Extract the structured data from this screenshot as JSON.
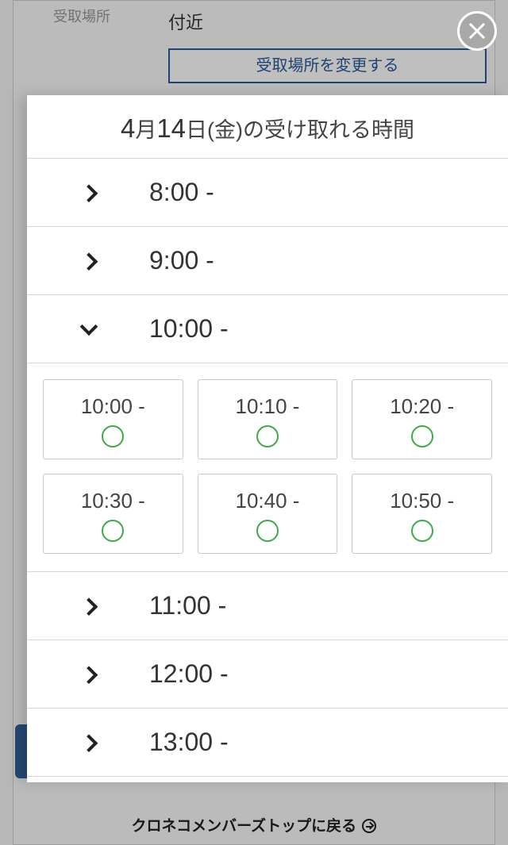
{
  "background": {
    "field_label": "受取場所",
    "field_value": "付近",
    "change_button": "受取場所を変更する",
    "footer_link": "クロネコメンバーズトップに戻る"
  },
  "modal": {
    "title": {
      "month_num": "4",
      "month_suffix": "月",
      "day_num": "14",
      "day_suffix": "日(金)の受け取れる時間"
    },
    "hours": [
      {
        "label": "8:00 -",
        "expanded": false
      },
      {
        "label": "9:00 -",
        "expanded": false
      },
      {
        "label": "10:00 -",
        "expanded": true,
        "slots": [
          {
            "time": "10:00 -",
            "available": true
          },
          {
            "time": "10:10 -",
            "available": true
          },
          {
            "time": "10:20 -",
            "available": true
          },
          {
            "time": "10:30 -",
            "available": true
          },
          {
            "time": "10:40 -",
            "available": true
          },
          {
            "time": "10:50 -",
            "available": true
          }
        ]
      },
      {
        "label": "11:00 -",
        "expanded": false
      },
      {
        "label": "12:00 -",
        "expanded": false
      },
      {
        "label": "13:00 -",
        "expanded": false
      }
    ]
  }
}
